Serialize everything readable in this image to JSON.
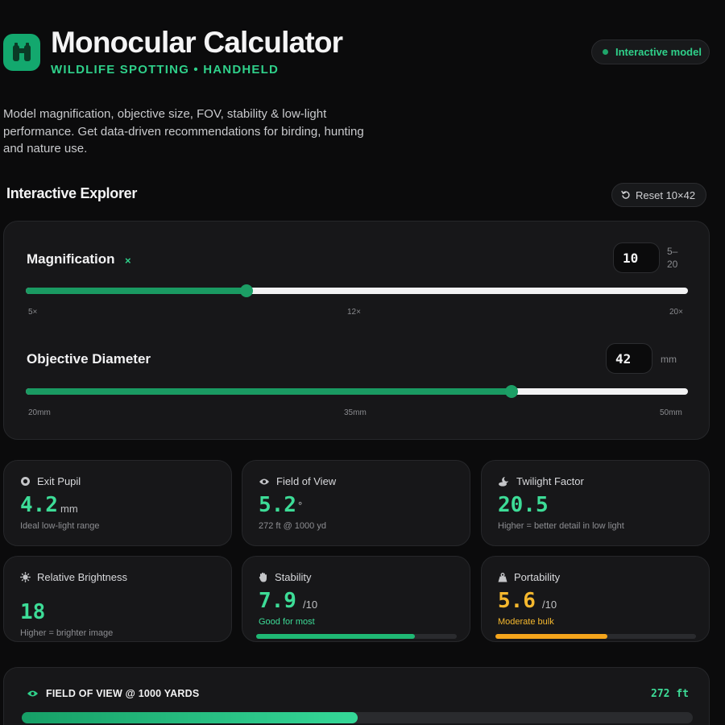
{
  "header": {
    "title": "Monocular Calculator",
    "subtitle": "WILDLIFE SPOTTING • HANDHELD",
    "badge": "Interactive model",
    "description": "Model magnification, objective size, FOV, stability & low-light performance. Get data-driven recommendations for birding, hunting and nature use."
  },
  "explorer": {
    "title": "Interactive Explorer",
    "reset_label": "Reset 10×42",
    "magnification": {
      "label": "Magnification",
      "unit": "×",
      "value": "10",
      "range_hint_min": "5–",
      "range_hint_max": "20",
      "min": 5,
      "max": 20,
      "current": 10,
      "tick_min": "5×",
      "tick_mid": "12×",
      "tick_max": "20×"
    },
    "objective": {
      "label": "Objective Diameter",
      "unit": "mm",
      "value": "42",
      "min": 20,
      "max": 50,
      "current": 42,
      "tick_min": "20mm",
      "tick_mid": "35mm",
      "tick_max": "50mm"
    }
  },
  "stats": {
    "exit_pupil": {
      "label": "Exit Pupil",
      "value": "4.2",
      "unit": "mm",
      "note": "Ideal low-light range",
      "icon": "target-icon"
    },
    "fov": {
      "label": "Field of View",
      "value": "5.2",
      "unit": "°",
      "note": "272 ft @ 1000 yd",
      "icon": "eye-icon"
    },
    "twilight": {
      "label": "Twilight Factor",
      "value": "20.5",
      "note": "Higher = better detail in low light",
      "icon": "moon-cloud-icon"
    },
    "brightness": {
      "label": "Relative Brightness",
      "value": "18",
      "note": "Higher = brighter image",
      "icon": "sun-icon"
    },
    "stability": {
      "label": "Stability",
      "value": "7.9",
      "unit": "/10",
      "note": "Good for most",
      "score": 7.9,
      "icon": "hand-icon"
    },
    "portability": {
      "label": "Portability",
      "value": "5.6",
      "unit": "/10",
      "note": "Moderate bulk",
      "score": 5.6,
      "icon": "weight-icon"
    }
  },
  "fov_bar": {
    "label": "FIELD OF VIEW @ 1000 YARDS",
    "value": "272 ft",
    "fraction": 0.5
  },
  "colors": {
    "accent": "#2fd08a",
    "value_green": "#3ddc97",
    "value_amber": "#f5b82e",
    "bar_green": "#1fb874",
    "bar_amber": "#f5a51c"
  }
}
